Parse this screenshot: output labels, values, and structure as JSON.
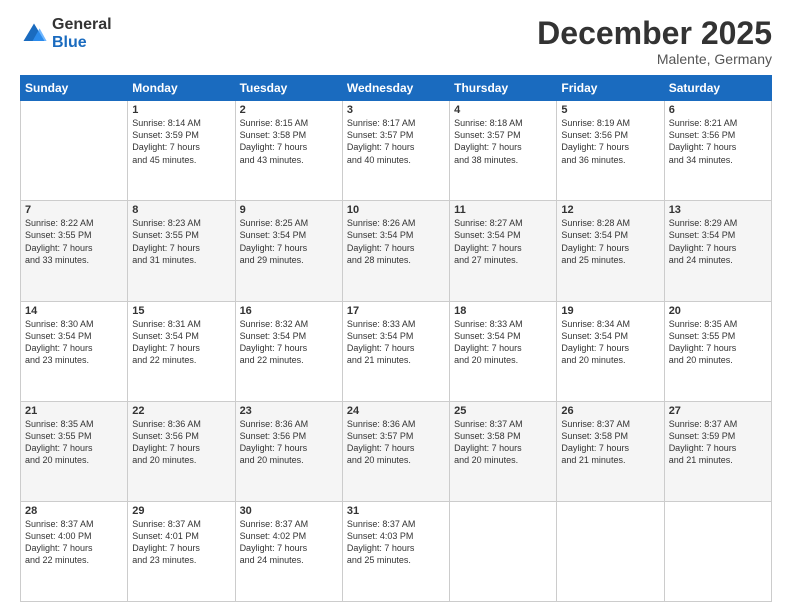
{
  "logo": {
    "general": "General",
    "blue": "Blue"
  },
  "header": {
    "month": "December 2025",
    "location": "Malente, Germany"
  },
  "weekdays": [
    "Sunday",
    "Monday",
    "Tuesday",
    "Wednesday",
    "Thursday",
    "Friday",
    "Saturday"
  ],
  "weeks": [
    [
      {
        "day": "",
        "info": ""
      },
      {
        "day": "1",
        "info": "Sunrise: 8:14 AM\nSunset: 3:59 PM\nDaylight: 7 hours\nand 45 minutes."
      },
      {
        "day": "2",
        "info": "Sunrise: 8:15 AM\nSunset: 3:58 PM\nDaylight: 7 hours\nand 43 minutes."
      },
      {
        "day": "3",
        "info": "Sunrise: 8:17 AM\nSunset: 3:57 PM\nDaylight: 7 hours\nand 40 minutes."
      },
      {
        "day": "4",
        "info": "Sunrise: 8:18 AM\nSunset: 3:57 PM\nDaylight: 7 hours\nand 38 minutes."
      },
      {
        "day": "5",
        "info": "Sunrise: 8:19 AM\nSunset: 3:56 PM\nDaylight: 7 hours\nand 36 minutes."
      },
      {
        "day": "6",
        "info": "Sunrise: 8:21 AM\nSunset: 3:56 PM\nDaylight: 7 hours\nand 34 minutes."
      }
    ],
    [
      {
        "day": "7",
        "info": "Sunrise: 8:22 AM\nSunset: 3:55 PM\nDaylight: 7 hours\nand 33 minutes."
      },
      {
        "day": "8",
        "info": "Sunrise: 8:23 AM\nSunset: 3:55 PM\nDaylight: 7 hours\nand 31 minutes."
      },
      {
        "day": "9",
        "info": "Sunrise: 8:25 AM\nSunset: 3:54 PM\nDaylight: 7 hours\nand 29 minutes."
      },
      {
        "day": "10",
        "info": "Sunrise: 8:26 AM\nSunset: 3:54 PM\nDaylight: 7 hours\nand 28 minutes."
      },
      {
        "day": "11",
        "info": "Sunrise: 8:27 AM\nSunset: 3:54 PM\nDaylight: 7 hours\nand 27 minutes."
      },
      {
        "day": "12",
        "info": "Sunrise: 8:28 AM\nSunset: 3:54 PM\nDaylight: 7 hours\nand 25 minutes."
      },
      {
        "day": "13",
        "info": "Sunrise: 8:29 AM\nSunset: 3:54 PM\nDaylight: 7 hours\nand 24 minutes."
      }
    ],
    [
      {
        "day": "14",
        "info": "Sunrise: 8:30 AM\nSunset: 3:54 PM\nDaylight: 7 hours\nand 23 minutes."
      },
      {
        "day": "15",
        "info": "Sunrise: 8:31 AM\nSunset: 3:54 PM\nDaylight: 7 hours\nand 22 minutes."
      },
      {
        "day": "16",
        "info": "Sunrise: 8:32 AM\nSunset: 3:54 PM\nDaylight: 7 hours\nand 22 minutes."
      },
      {
        "day": "17",
        "info": "Sunrise: 8:33 AM\nSunset: 3:54 PM\nDaylight: 7 hours\nand 21 minutes."
      },
      {
        "day": "18",
        "info": "Sunrise: 8:33 AM\nSunset: 3:54 PM\nDaylight: 7 hours\nand 20 minutes."
      },
      {
        "day": "19",
        "info": "Sunrise: 8:34 AM\nSunset: 3:54 PM\nDaylight: 7 hours\nand 20 minutes."
      },
      {
        "day": "20",
        "info": "Sunrise: 8:35 AM\nSunset: 3:55 PM\nDaylight: 7 hours\nand 20 minutes."
      }
    ],
    [
      {
        "day": "21",
        "info": "Sunrise: 8:35 AM\nSunset: 3:55 PM\nDaylight: 7 hours\nand 20 minutes."
      },
      {
        "day": "22",
        "info": "Sunrise: 8:36 AM\nSunset: 3:56 PM\nDaylight: 7 hours\nand 20 minutes."
      },
      {
        "day": "23",
        "info": "Sunrise: 8:36 AM\nSunset: 3:56 PM\nDaylight: 7 hours\nand 20 minutes."
      },
      {
        "day": "24",
        "info": "Sunrise: 8:36 AM\nSunset: 3:57 PM\nDaylight: 7 hours\nand 20 minutes."
      },
      {
        "day": "25",
        "info": "Sunrise: 8:37 AM\nSunset: 3:58 PM\nDaylight: 7 hours\nand 20 minutes."
      },
      {
        "day": "26",
        "info": "Sunrise: 8:37 AM\nSunset: 3:58 PM\nDaylight: 7 hours\nand 21 minutes."
      },
      {
        "day": "27",
        "info": "Sunrise: 8:37 AM\nSunset: 3:59 PM\nDaylight: 7 hours\nand 21 minutes."
      }
    ],
    [
      {
        "day": "28",
        "info": "Sunrise: 8:37 AM\nSunset: 4:00 PM\nDaylight: 7 hours\nand 22 minutes."
      },
      {
        "day": "29",
        "info": "Sunrise: 8:37 AM\nSunset: 4:01 PM\nDaylight: 7 hours\nand 23 minutes."
      },
      {
        "day": "30",
        "info": "Sunrise: 8:37 AM\nSunset: 4:02 PM\nDaylight: 7 hours\nand 24 minutes."
      },
      {
        "day": "31",
        "info": "Sunrise: 8:37 AM\nSunset: 4:03 PM\nDaylight: 7 hours\nand 25 minutes."
      },
      {
        "day": "",
        "info": ""
      },
      {
        "day": "",
        "info": ""
      },
      {
        "day": "",
        "info": ""
      }
    ]
  ]
}
